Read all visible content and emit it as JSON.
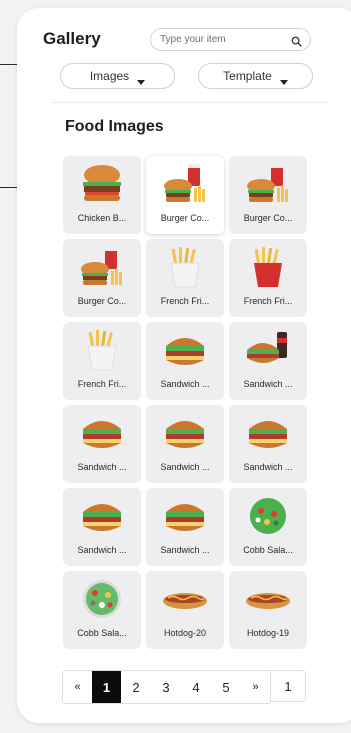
{
  "header": {
    "title": "Gallery",
    "search": {
      "placeholder": "Type your item",
      "value": "",
      "icon": "search-icon"
    }
  },
  "filters": {
    "images_label": "Images",
    "template_label": "Template"
  },
  "section_title": "Food Images",
  "items": [
    {
      "label": "Chicken B...",
      "icon": "burger-icon",
      "selected": false
    },
    {
      "label": "Burger Co...",
      "icon": "burger-combo-icon",
      "selected": true
    },
    {
      "label": "Burger Co...",
      "icon": "burger-combo-icon",
      "selected": false
    },
    {
      "label": "Burger Co...",
      "icon": "burger-combo-icon",
      "selected": false
    },
    {
      "label": "French Fri...",
      "icon": "fries-white-icon",
      "selected": false
    },
    {
      "label": "French Fri...",
      "icon": "fries-red-icon",
      "selected": false
    },
    {
      "label": "French Fri...",
      "icon": "fries-white-icon",
      "selected": false
    },
    {
      "label": "Sandwich ...",
      "icon": "sandwich-icon",
      "selected": false
    },
    {
      "label": "Sandwich ...",
      "icon": "sandwich-drink-icon",
      "selected": false
    },
    {
      "label": "Sandwich ...",
      "icon": "sandwich-icon",
      "selected": false
    },
    {
      "label": "Sandwich ...",
      "icon": "sandwich-icon",
      "selected": false
    },
    {
      "label": "Sandwich ...",
      "icon": "sandwich-icon",
      "selected": false
    },
    {
      "label": "Sandwich ...",
      "icon": "sandwich-icon",
      "selected": false
    },
    {
      "label": "Sandwich ...",
      "icon": "sandwich-icon",
      "selected": false
    },
    {
      "label": "Cobb Sala...",
      "icon": "salad-icon",
      "selected": false
    },
    {
      "label": "Cobb Sala...",
      "icon": "salad-bowl-icon",
      "selected": false
    },
    {
      "label": "Hotdog-20",
      "icon": "hotdog-icon",
      "selected": false
    },
    {
      "label": "Hotdog-19",
      "icon": "hotdog-icon",
      "selected": false
    }
  ],
  "pagination": {
    "prev": "«",
    "pages": [
      "1",
      "2",
      "3",
      "4",
      "5"
    ],
    "active": "1",
    "next": "»",
    "current_input": "1"
  },
  "colors": {
    "panel_bg": "#ffffff",
    "page_bg": "#f3f3f5",
    "card_bg": "#eeeef1",
    "active_page": "#0b0b0b"
  }
}
